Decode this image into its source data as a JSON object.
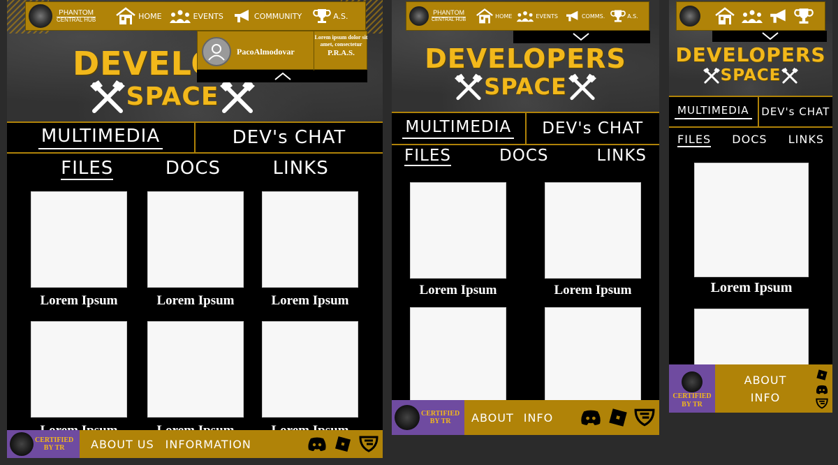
{
  "brand": {
    "line1": "PHANTOM",
    "line2": "CENTRAL HUB"
  },
  "nav": {
    "home": "HOME",
    "events": "EVENTS",
    "community": "COMMUNITY",
    "comms": "COMMS.",
    "as": "A.S."
  },
  "hero": {
    "title": "DEVELOPERS",
    "title_cropped": "DEVELO",
    "subtitle": "SPACE"
  },
  "profile": {
    "username": "PacoAlmodovar",
    "info_text": "Lorem ipsum dolor sit amet, consectetur",
    "info_tag": "P.R.A.S."
  },
  "sections": {
    "multimedia": "MULTIMEDIA",
    "devs_chat": "DEV's CHAT"
  },
  "tabs": {
    "files": "FILES",
    "docs": "DOCS",
    "links": "LINKS"
  },
  "card_caption": "Lorem Ipsum",
  "card_caption_cropped": "Lorem Ipsum",
  "footer": {
    "certified": "CERTIFIED",
    "by": "BY TR",
    "about_us": "ABOUT US",
    "information": "INFORMATION",
    "about": "ABOUT",
    "info": "INFO"
  },
  "icons": [
    "logo-badge",
    "home-icon",
    "events-icon",
    "megaphone-icon",
    "trophy-icon",
    "hammer-icon",
    "user-avatar-icon",
    "chevron-up-icon",
    "chevron-down-icon",
    "discord-icon",
    "roblox-icon",
    "guilded-icon"
  ],
  "colors": {
    "gold": "#b08308",
    "title_gold": "#f2b81b",
    "purple": "#6f4ba0",
    "black": "#000000"
  }
}
